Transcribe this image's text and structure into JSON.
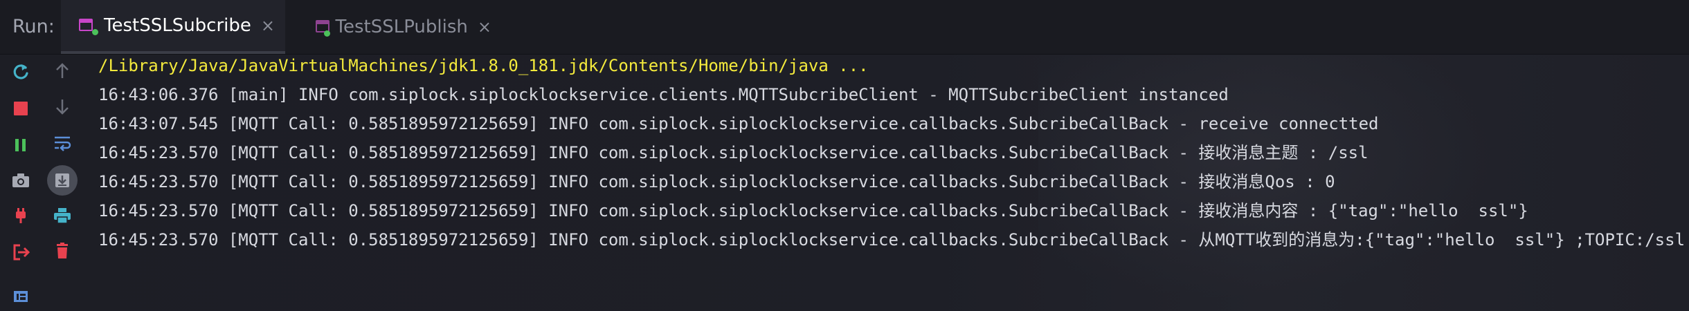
{
  "run_panel": {
    "label": "Run:",
    "tabs": [
      {
        "label": "TestSSLSubcribe",
        "active": true,
        "close_icon": "×"
      },
      {
        "label": "TestSSLPublish",
        "active": false,
        "close_icon": "×"
      }
    ]
  },
  "toolbar_left": [
    {
      "name": "rerun-icon",
      "color": "#45b3c9"
    },
    {
      "name": "stop-icon",
      "color": "#e8424f"
    },
    {
      "name": "pause-icon",
      "color": "#4cc15b"
    },
    {
      "name": "camera-icon",
      "color": "#a7aab4"
    },
    {
      "name": "plug-icon",
      "color": "#e8424f"
    },
    {
      "name": "exit-icon",
      "color": "#e8424f"
    },
    {
      "name": "layout-icon",
      "color": "#5c8fd8"
    }
  ],
  "toolbar_right": [
    {
      "name": "arrow-up-icon",
      "color": "#6c6f7a"
    },
    {
      "name": "arrow-down-icon",
      "color": "#6c6f7a"
    },
    {
      "name": "soft-wrap-icon",
      "color": "#5c8fd8"
    },
    {
      "name": "scroll-to-end-icon",
      "color": "#a7aab4"
    },
    {
      "name": "print-icon",
      "color": "#45b3c9"
    },
    {
      "name": "trash-icon",
      "color": "#e8424f"
    }
  ],
  "console": {
    "lines": [
      "/Library/Java/JavaVirtualMachines/jdk1.8.0_181.jdk/Contents/Home/bin/java ...",
      "16:43:06.376 [main] INFO com.siplock.siplocklockservice.clients.MQTTSubcribeClient - MQTTSubcribeClient instanced",
      "16:43:07.545 [MQTT Call: 0.5851895972125659] INFO com.siplock.siplocklockservice.callbacks.SubcribeCallBack - receive connectted",
      "16:45:23.570 [MQTT Call: 0.5851895972125659] INFO com.siplock.siplocklockservice.callbacks.SubcribeCallBack - 接收消息主题 : /ssl",
      "16:45:23.570 [MQTT Call: 0.5851895972125659] INFO com.siplock.siplocklockservice.callbacks.SubcribeCallBack - 接收消息Qos : 0",
      "16:45:23.570 [MQTT Call: 0.5851895972125659] INFO com.siplock.siplocklockservice.callbacks.SubcribeCallBack - 接收消息内容 : {\"tag\":\"hello  ssl\"}",
      "16:45:23.570 [MQTT Call: 0.5851895972125659] INFO com.siplock.siplocklockservice.callbacks.SubcribeCallBack - 从MQTT收到的消息为:{\"tag\":\"hello  ssl\"} ;TOPIC:/ssl"
    ],
    "command_color": "#f4ea3c",
    "log_color": "#d7d9e0"
  },
  "colors": {
    "background": "#1e1f27",
    "tab_active_text": "#ffffff",
    "tab_inactive_text": "#8a8d98",
    "tab_icon": "#c846c8"
  }
}
